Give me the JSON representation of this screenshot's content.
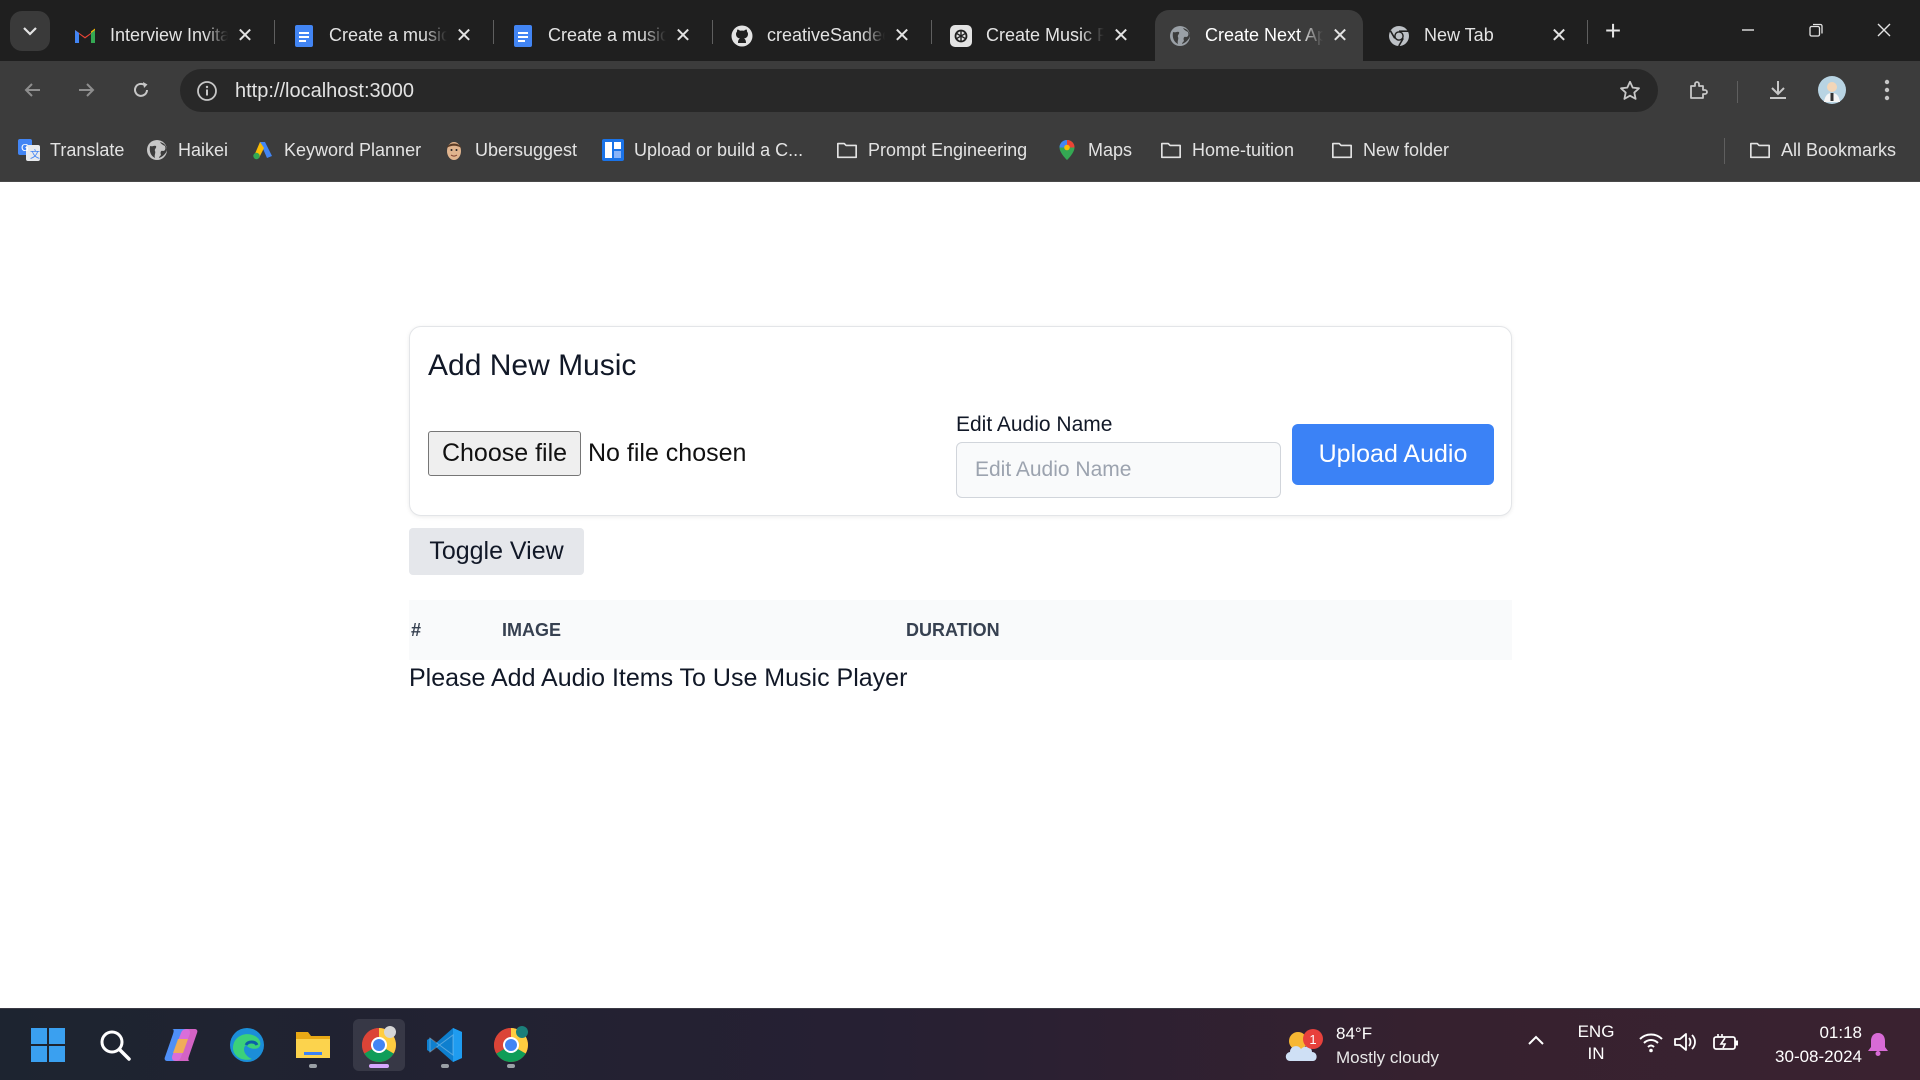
{
  "browser": {
    "tabs": [
      {
        "title": "Interview Invitation",
        "favicon": "gmail-icon"
      },
      {
        "title": "Create a music",
        "favicon": "google-docs-icon"
      },
      {
        "title": "Create a music",
        "favicon": "google-docs-icon"
      },
      {
        "title": "creativeSandeep",
        "favicon": "github-icon"
      },
      {
        "title": "Create Music Player",
        "favicon": "openai-icon"
      },
      {
        "title": "Create Next App",
        "favicon": "globe-icon",
        "active": true
      },
      {
        "title": "New Tab",
        "favicon": "chrome-icon"
      }
    ],
    "address_bar": {
      "url": "http://localhost:3000"
    },
    "bookmarks": [
      {
        "label": "Translate",
        "icon": "google-translate-icon"
      },
      {
        "label": "Haikei",
        "icon": "globe-icon"
      },
      {
        "label": "Keyword Planner",
        "icon": "google-ads-icon"
      },
      {
        "label": "Ubersuggest",
        "icon": "ubersuggest-icon"
      },
      {
        "label": "Upload or build a C...",
        "icon": "upload-icon"
      },
      {
        "label": "Prompt Engineering",
        "icon": "folder-icon"
      },
      {
        "label": "Maps",
        "icon": "maps-pin-icon"
      },
      {
        "label": "Home-tuition",
        "icon": "folder-icon"
      },
      {
        "label": "New folder",
        "icon": "folder-icon"
      }
    ],
    "all_bookmarks_label": "All Bookmarks"
  },
  "page": {
    "card_title": "Add New Music",
    "file_input": {
      "button_label": "Choose file",
      "status": "No file chosen"
    },
    "audio_name": {
      "label": "Edit Audio Name",
      "placeholder": "Edit Audio Name",
      "value": ""
    },
    "upload_button": "Upload Audio",
    "toggle_button": "Toggle View",
    "table": {
      "columns": [
        "#",
        "IMAGE",
        "DURATION"
      ]
    },
    "empty_message": "Please Add Audio Items To Use Music Player"
  },
  "taskbar": {
    "apps": [
      "windows-start-icon",
      "search-icon",
      "copilot-icon",
      "edge-icon",
      "file-explorer-icon",
      "chrome-icon",
      "vscode-icon",
      "chrome-icon"
    ],
    "weather": {
      "temperature": "84°F",
      "condition": "Mostly cloudy",
      "badge": "1"
    },
    "language": {
      "line1": "ENG",
      "line2": "IN"
    },
    "clock": {
      "time": "01:18",
      "date": "30-08-2024"
    }
  },
  "colors": {
    "accent": "#3b82f6",
    "browser_bg": "#3c3c3c",
    "tabstrip_bg": "#1f1f1f"
  }
}
